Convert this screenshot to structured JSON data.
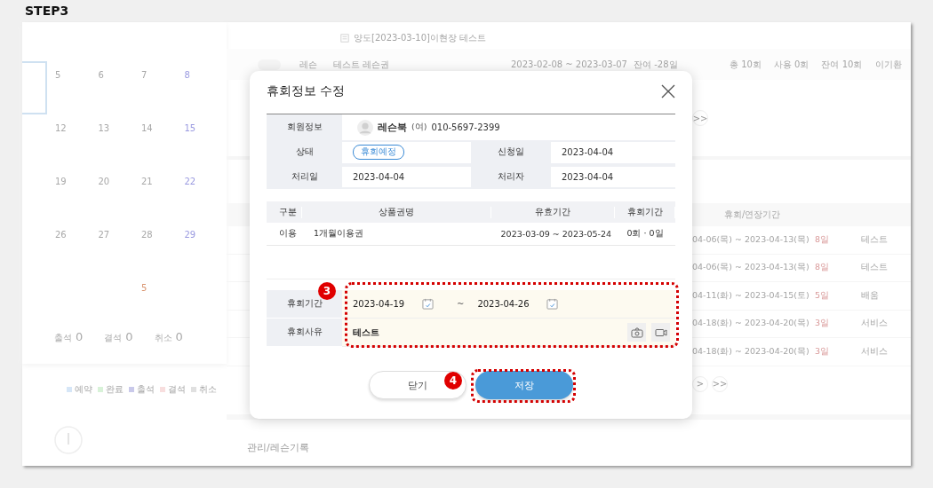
{
  "heading": "STEP3",
  "background": {
    "calendar": {
      "weeks": [
        [
          {
            "kind": "cut",
            "selected": true
          },
          {
            "day": "5",
            "kind": "weekday",
            "selected": false
          },
          {
            "day": "6",
            "kind": "weekday",
            "selected": false
          },
          {
            "day": "7",
            "kind": "weekday",
            "selected": false
          },
          {
            "day": "8",
            "kind": "saturday",
            "selected": false
          }
        ],
        [
          {
            "kind": "cut",
            "selected": false
          },
          {
            "day": "12",
            "kind": "weekday",
            "selected": false
          },
          {
            "day": "13",
            "kind": "weekday",
            "selected": false
          },
          {
            "day": "14",
            "kind": "weekday",
            "selected": false
          },
          {
            "day": "15",
            "kind": "saturday",
            "selected": false
          }
        ],
        [
          {
            "kind": "cut",
            "selected": false
          },
          {
            "day": "19",
            "kind": "weekday",
            "selected": false
          },
          {
            "day": "20",
            "kind": "weekday",
            "selected": false
          },
          {
            "day": "21",
            "kind": "weekday",
            "selected": false
          },
          {
            "day": "22",
            "kind": "saturday",
            "selected": false
          }
        ],
        [
          {
            "kind": "cut",
            "selected": false
          },
          {
            "day": "26",
            "kind": "weekday",
            "selected": false
          },
          {
            "day": "27",
            "kind": "weekday",
            "selected": false
          },
          {
            "day": "28",
            "kind": "weekday",
            "selected": false
          },
          {
            "day": "29",
            "kind": "saturday",
            "selected": false
          }
        ],
        [
          {
            "kind": "cut",
            "selected": false
          },
          {
            "kind": "blank",
            "selected": false
          },
          {
            "kind": "blank",
            "selected": false
          },
          {
            "day": "5",
            "kind": "holiday",
            "selected": false
          },
          {
            "kind": "blank",
            "selected": false
          }
        ]
      ]
    },
    "stats": [
      {
        "label": "출석",
        "value": "0"
      },
      {
        "label": "결석",
        "value": "0"
      },
      {
        "label": "취소",
        "value": "0"
      }
    ],
    "legend": [
      {
        "label": "예약",
        "color": "#d6e6f7"
      },
      {
        "label": "완료",
        "color": "#d8f2d8"
      },
      {
        "label": "출석",
        "color": "#c9c9ea"
      },
      {
        "label": "결석",
        "color": "#f8dede"
      },
      {
        "label": "취소",
        "color": "#e0e0e0"
      }
    ],
    "transfer_note": "양도[2023-03-10]이현장 테스트",
    "pass_row": {
      "type": "레슨",
      "name": "테스트 레슨권",
      "period": "2023-02-08 ~ 2023-03-07",
      "remaining": "잔여 -28일",
      "total": "총 10회",
      "used": "사용 0회",
      "left": "잔여 10회",
      "manager": "이기환"
    },
    "pager_top": [
      ">>"
    ],
    "history": {
      "columns": [
        "휴회/연장기간"
      ],
      "rows": [
        {
          "period": "04-06(목) ~ 2023-04-13(목)",
          "days": "8일",
          "reason": "테스트"
        },
        {
          "period": "04-06(목) ~ 2023-04-13(목)",
          "days": "8일",
          "reason": "테스트"
        },
        {
          "period": "04-11(화) ~ 2023-04-15(토)",
          "days": "5일",
          "reason": "배움"
        },
        {
          "period": "04-18(화) ~ 2023-04-20(목)",
          "days": "3일",
          "reason": "서비스"
        },
        {
          "period": "04-18(화) ~ 2023-04-20(목)",
          "days": "3일",
          "reason": "서비스"
        }
      ]
    },
    "pager_bottom": [
      ">",
      ">>"
    ],
    "section_title": "관리/레슨기록"
  },
  "modal": {
    "title": "휴회정보 수정",
    "member": {
      "label": "회원정보",
      "name": "레슨북",
      "gender": "(여)",
      "phone": "010-5697-2399"
    },
    "fields": [
      {
        "label": "상태",
        "value": "휴회예정",
        "kind": "badge"
      },
      {
        "label": "신청일",
        "value": "2023-04-04",
        "kind": "text"
      },
      {
        "label": "처리일",
        "value": "2023-04-04",
        "kind": "text"
      },
      {
        "label": "처리자",
        "value": "2023-04-04",
        "kind": "text"
      }
    ],
    "products": {
      "columns": [
        "구분",
        "상품권명",
        "유효기간",
        "휴회기간"
      ],
      "rows": [
        [
          "이용",
          "1개월이용권",
          "2023-03-09 ~ 2023-05-24",
          "0회 · 0일"
        ]
      ]
    },
    "period": {
      "label": "휴회기간",
      "start": "2023-04-19",
      "separator": "~",
      "end": "2023-04-26"
    },
    "reason": {
      "label": "휴회사유",
      "value": "테스트"
    },
    "buttons": [
      {
        "label": "닫기",
        "kind": "secondary"
      },
      {
        "label": "저장",
        "kind": "primary"
      }
    ]
  },
  "annotations": [
    {
      "number": "3"
    },
    {
      "number": "4"
    }
  ]
}
